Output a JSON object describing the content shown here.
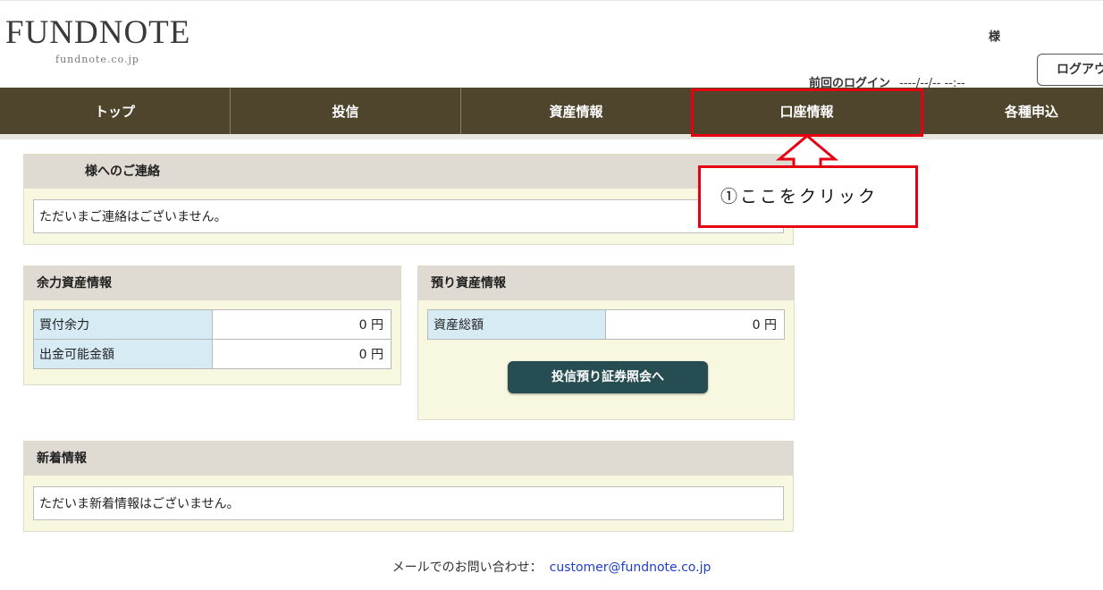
{
  "header": {
    "logo_main": "FUNDNOTE",
    "logo_sub": "fundnote.co.jp",
    "user_suffix": "様",
    "last_login_label": "前回のログイン",
    "last_login_value": "----/--/-- --:--",
    "logout_label": "ログアウト"
  },
  "nav": {
    "items": [
      {
        "label": "トップ"
      },
      {
        "label": "投信"
      },
      {
        "label": "資産情報"
      },
      {
        "label": "口座情報"
      },
      {
        "label": "各種申込"
      }
    ]
  },
  "notice": {
    "title": "様へのご連絡",
    "message": "ただいまご連絡はございません。"
  },
  "available_assets": {
    "title": "余力資産情報",
    "rows": [
      {
        "label": "買付余力",
        "value": "0 円"
      },
      {
        "label": "出金可能金額",
        "value": "0 円"
      }
    ]
  },
  "deposit_assets": {
    "title": "預り資産情報",
    "rows": [
      {
        "label": "資産総額",
        "value": "0 円"
      }
    ],
    "button_label": "投信預り証券照会へ"
  },
  "news": {
    "title": "新着情報",
    "message": "ただいま新着情報はございません。"
  },
  "footer": {
    "contact_label": "メールでのお問い合わせ：",
    "contact_email": "customer@fundnote.co.jp"
  },
  "annotation": {
    "callout_text": "①ここをクリック",
    "color": "#e60012"
  }
}
